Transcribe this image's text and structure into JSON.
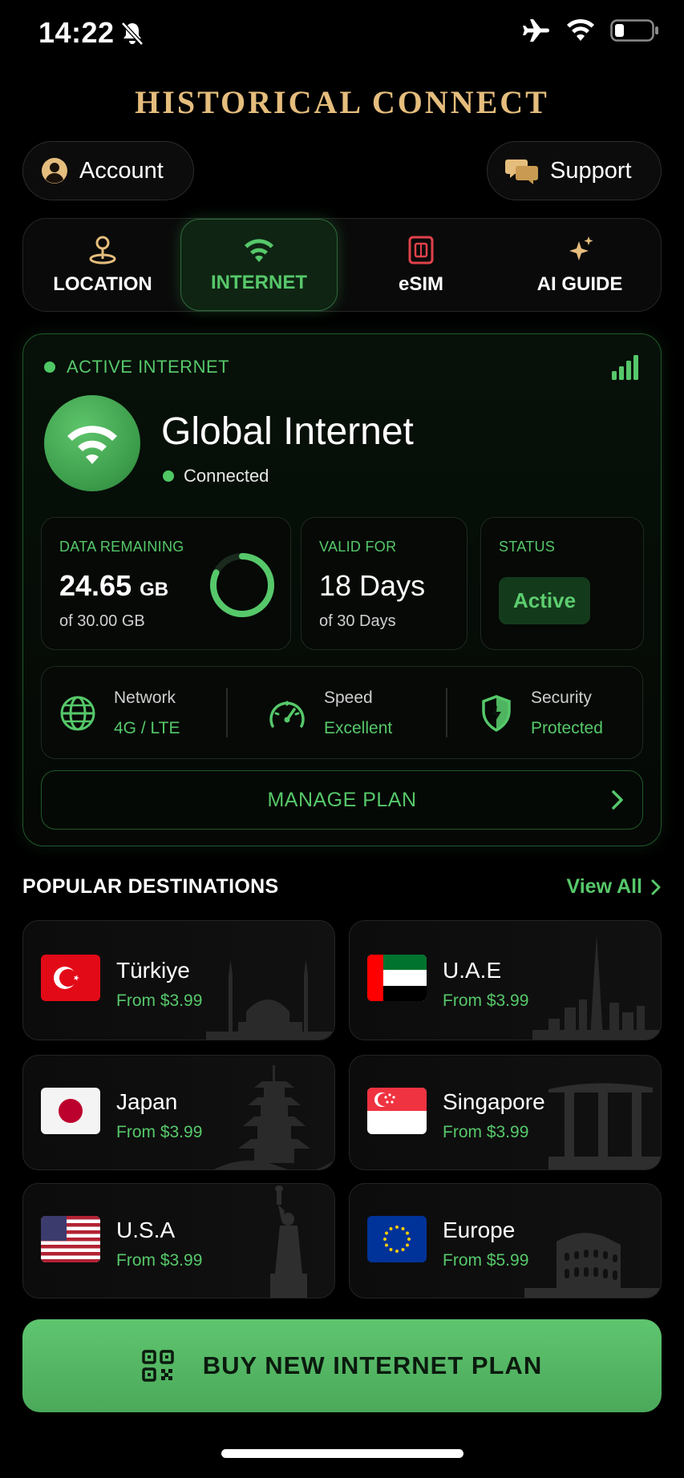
{
  "status_bar": {
    "time": "14:22"
  },
  "app": {
    "title": "HISTORICAL CONNECT"
  },
  "header": {
    "account_label": "Account",
    "support_label": "Support"
  },
  "tabs": [
    {
      "label": "LOCATION"
    },
    {
      "label": "INTERNET"
    },
    {
      "label": "eSIM"
    },
    {
      "label": "AI GUIDE"
    }
  ],
  "active_plan": {
    "section_label": "ACTIVE INTERNET",
    "name": "Global Internet",
    "connection_status": "Connected",
    "data_remaining": {
      "label": "DATA REMAINING",
      "value": "24.65",
      "unit": "GB",
      "total": "of 30.00 GB",
      "fraction": 0.82
    },
    "valid_for": {
      "label": "VALID FOR",
      "value": "18 Days",
      "total": "of 30 Days"
    },
    "status": {
      "label": "STATUS",
      "value": "Active"
    },
    "network": {
      "title": "Network",
      "value": "4G / LTE"
    },
    "speed": {
      "title": "Speed",
      "value": "Excellent"
    },
    "security": {
      "title": "Security",
      "value": "Protected"
    },
    "manage_label": "MANAGE PLAN"
  },
  "destinations": {
    "title": "POPULAR DESTINATIONS",
    "view_all": "View All",
    "items": [
      {
        "name": "Türkiye",
        "price": "From $3.99"
      },
      {
        "name": "U.A.E",
        "price": "From $3.99"
      },
      {
        "name": "Japan",
        "price": "From $3.99"
      },
      {
        "name": "Singapore",
        "price": "From $3.99"
      },
      {
        "name": "U.S.A",
        "price": "From $3.99"
      },
      {
        "name": "Europe",
        "price": "From $5.99"
      }
    ]
  },
  "buy_button": {
    "label": "BUY NEW INTERNET PLAN"
  },
  "colors": {
    "accent_green": "#56c86a",
    "gold": "#e5bd7d",
    "background": "#000000"
  }
}
